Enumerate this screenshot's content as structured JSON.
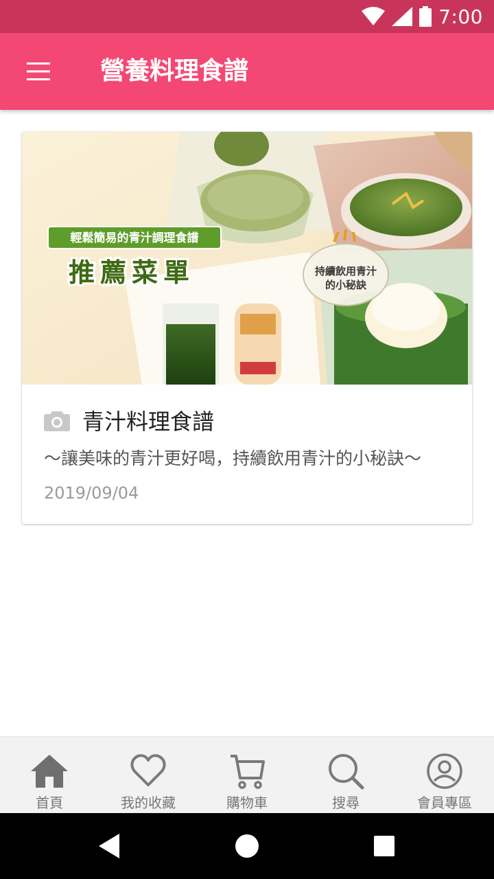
{
  "status_bar": {
    "time": "7:00",
    "bg_color": "#c9355a"
  },
  "app_bar": {
    "title": "營養料理食譜",
    "menu_icon": "hamburger-menu-icon",
    "bg_color": "#f34874"
  },
  "card": {
    "banner": {
      "tag_text": "輕鬆簡易的青汁調理食譜",
      "headline": "推薦菜單",
      "badge_text_line1": "持續飲用青汁",
      "badge_text_line2": "的小秘訣"
    },
    "icon": "camera-icon",
    "title": "青汁料理食譜",
    "description": "～讓美味的青汁更好喝，持續飲用青汁的小秘訣～",
    "date": "2019/09/04"
  },
  "bottom_nav": {
    "items": [
      {
        "label": "首頁",
        "icon": "home-icon"
      },
      {
        "label": "我的收藏",
        "icon": "heart-icon"
      },
      {
        "label": "購物車",
        "icon": "cart-icon"
      },
      {
        "label": "搜尋",
        "icon": "search-icon"
      },
      {
        "label": "會員專區",
        "icon": "account-icon"
      }
    ]
  }
}
